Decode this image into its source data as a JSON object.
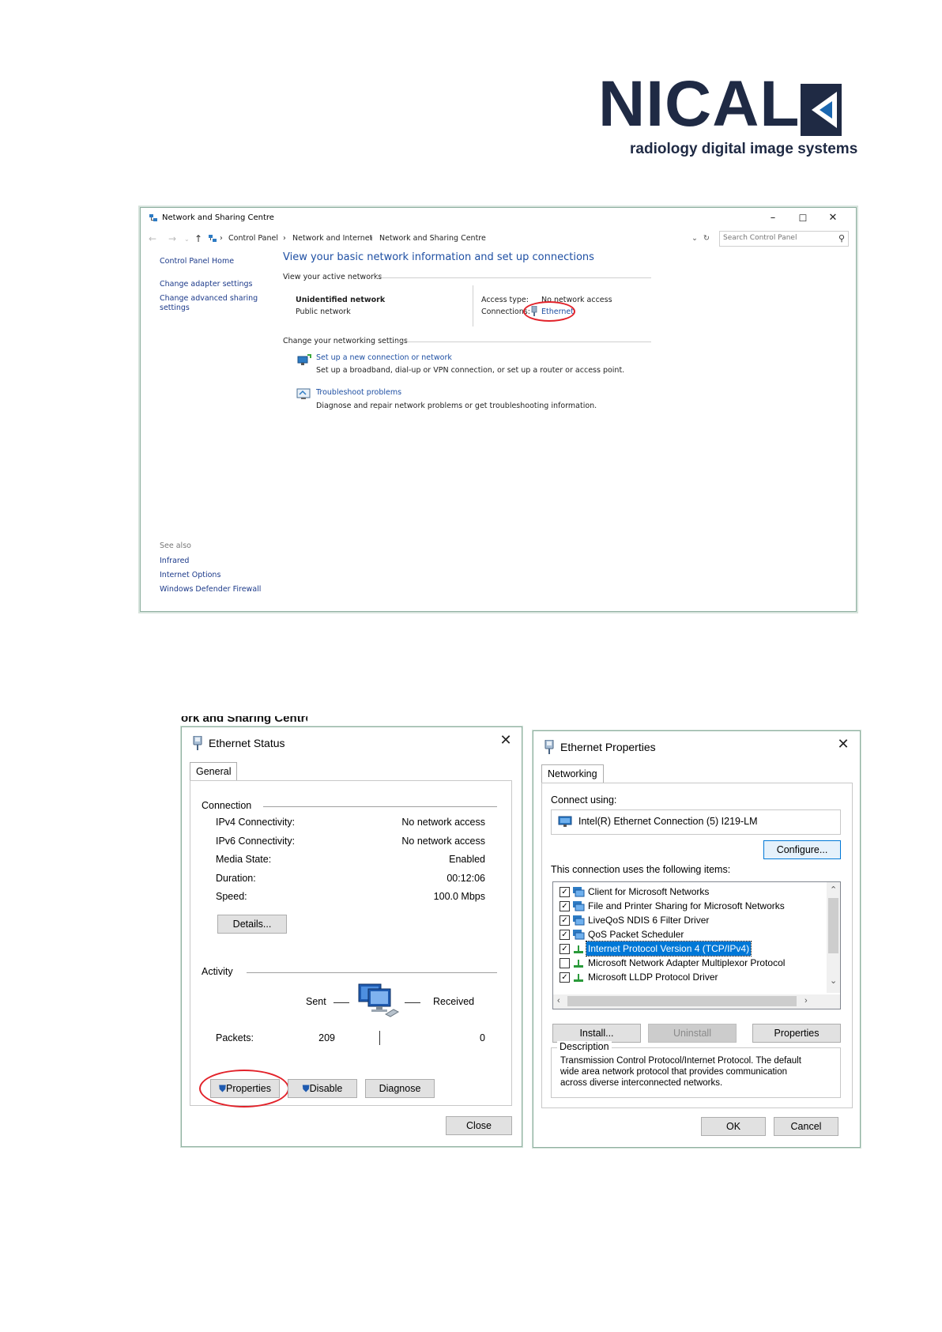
{
  "logo": {
    "wordmark": "NICAL",
    "tagline": "radiology digital image systems",
    "colors": {
      "navy": "#1f2a44",
      "blue": "#1b67b0"
    }
  },
  "network_centre": {
    "title": "Network and Sharing Centre",
    "window_controls": {
      "minimize": "–",
      "maximize": "☐",
      "close": "✕"
    },
    "breadcrumb": [
      "Control Panel",
      "Network and Internet",
      "Network and Sharing Centre"
    ],
    "search_placeholder": "Search Control Panel",
    "sidebar": {
      "home": "Control Panel Home",
      "links": [
        "Change adapter settings",
        "Change advanced sharing settings"
      ],
      "see_also_label": "See also",
      "see_also": [
        "Infrared",
        "Internet Options",
        "Windows Defender Firewall"
      ]
    },
    "heading": "View your basic network information and set up connections",
    "active_networks_label": "View your active networks",
    "network_name": "Unidentified network",
    "network_type": "Public network",
    "access_type_label": "Access type:",
    "access_type_value": "No network access",
    "connections_label": "Connections:",
    "connections_value": "Ethernet",
    "change_settings_label": "Change your networking settings",
    "tasks": [
      {
        "link": "Set up a new connection or network",
        "desc": "Set up a broadband, dial-up or VPN connection, or set up a router or access point."
      },
      {
        "link": "Troubleshoot problems",
        "desc": "Diagnose and repair network problems or get troubleshooting information."
      }
    ]
  },
  "ethernet_status": {
    "title": "Ethernet Status",
    "tab": "General",
    "connection_label": "Connection",
    "rows": [
      {
        "label": "IPv4 Connectivity:",
        "value": "No network access"
      },
      {
        "label": "IPv6 Connectivity:",
        "value": "No network access"
      },
      {
        "label": "Media State:",
        "value": "Enabled"
      },
      {
        "label": "Duration:",
        "value": "00:12:06"
      },
      {
        "label": "Speed:",
        "value": "100.0 Mbps"
      }
    ],
    "details_button": "Details...",
    "activity_label": "Activity",
    "sent_label": "Sent",
    "received_label": "Received",
    "packets_label": "Packets:",
    "packets_sent": "209",
    "packets_received": "0",
    "properties_button": "Properties",
    "disable_button": "Disable",
    "diagnose_button": "Diagnose",
    "close_button": "Close",
    "background_title_fragment": "ork and Sharing Centre"
  },
  "ethernet_properties": {
    "title": "Ethernet Properties",
    "tab": "Networking",
    "connect_using_label": "Connect using:",
    "adapter": "Intel(R) Ethernet Connection (5) I219-LM",
    "configure_button": "Configure...",
    "items_label": "This connection uses the following items:",
    "items": [
      {
        "label": "Client for Microsoft Networks",
        "checked": true,
        "selected": false
      },
      {
        "label": "File and Printer Sharing for Microsoft Networks",
        "checked": true,
        "selected": false
      },
      {
        "label": "LiveQoS NDIS 6 Filter Driver",
        "checked": true,
        "selected": false
      },
      {
        "label": "QoS Packet Scheduler",
        "checked": true,
        "selected": false
      },
      {
        "label": "Internet Protocol Version 4 (TCP/IPv4)",
        "checked": true,
        "selected": true
      },
      {
        "label": "Microsoft Network Adapter Multiplexor Protocol",
        "checked": false,
        "selected": false
      },
      {
        "label": "Microsoft LLDP Protocol Driver",
        "checked": true,
        "selected": false
      }
    ],
    "install_button": "Install...",
    "uninstall_button": "Uninstall",
    "properties_button": "Properties",
    "description_label": "Description",
    "description": "Transmission Control Protocol/Internet Protocol. The default wide area network protocol that provides communication across diverse interconnected networks.",
    "ok_button": "OK",
    "cancel_button": "Cancel"
  },
  "annotation_color": "#e2222a"
}
